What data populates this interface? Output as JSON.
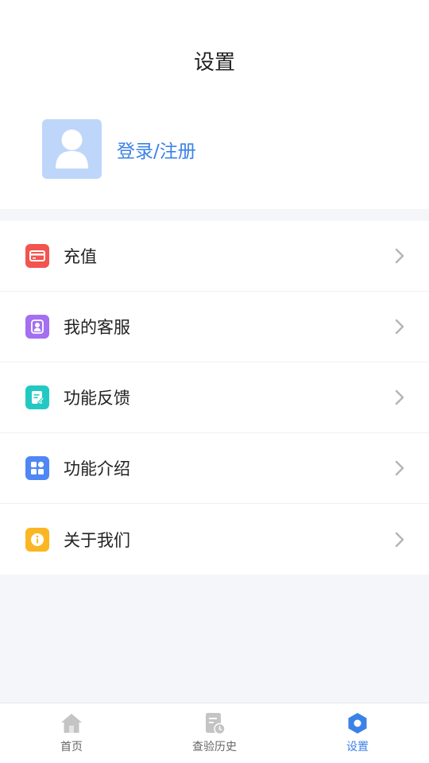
{
  "header": {
    "title": "设置"
  },
  "profile": {
    "login_label": "登录/注册"
  },
  "menu": {
    "items": [
      {
        "label": "充值",
        "icon": "card-icon",
        "color": "#f2544f"
      },
      {
        "label": "我的客服",
        "icon": "service-icon",
        "color": "#a46ff0"
      },
      {
        "label": "功能反馈",
        "icon": "feedback-icon",
        "color": "#22c9c3"
      },
      {
        "label": "功能介绍",
        "icon": "apps-icon",
        "color": "#4f87f5"
      },
      {
        "label": "关于我们",
        "icon": "info-icon",
        "color": "#fbb624"
      }
    ]
  },
  "tabbar": {
    "tabs": [
      {
        "label": "首页",
        "icon": "home-icon"
      },
      {
        "label": "查验历史",
        "icon": "history-icon"
      },
      {
        "label": "设置",
        "icon": "settings-icon",
        "active": true
      }
    ]
  },
  "colors": {
    "accent": "#3b82e8",
    "background": "#f4f6fa"
  }
}
